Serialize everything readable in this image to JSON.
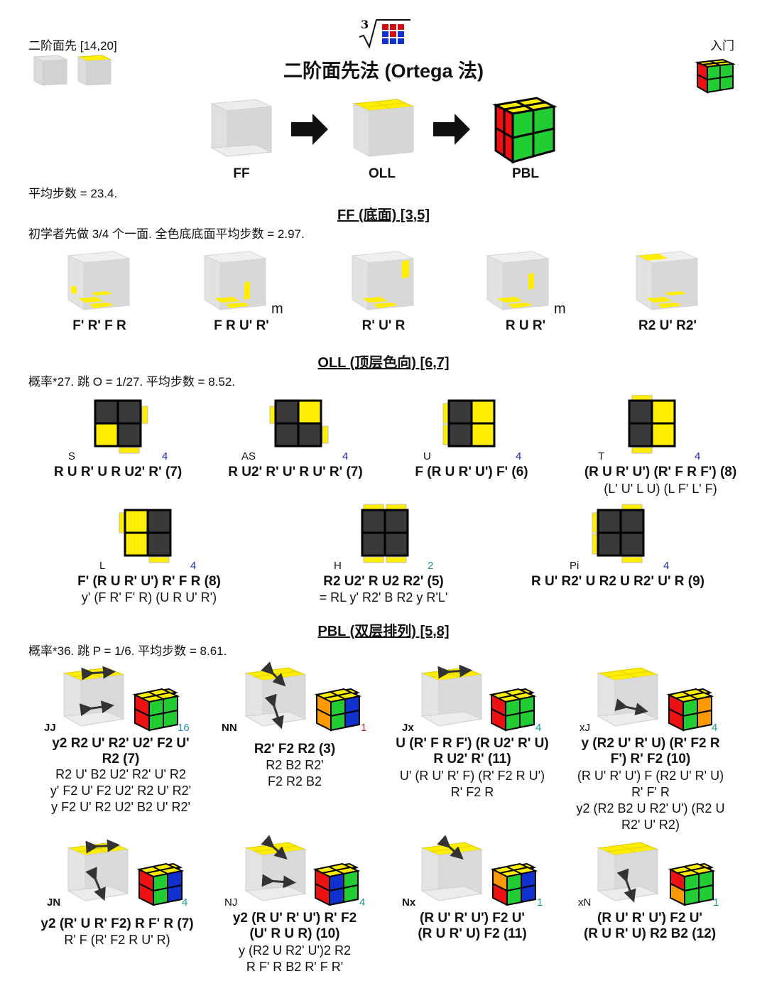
{
  "header": {
    "left_label": "二阶面先 [14,20]",
    "right_label": "入门",
    "title": "二阶面先法 (Ortega 法)",
    "root_index": "3"
  },
  "stages": [
    "FF",
    "OLL",
    "PBL"
  ],
  "avg_moves": "平均步数 = 23.4.",
  "ff": {
    "title": "FF (底面) [3,5]",
    "desc": "初学者先做 3/4 个一面. 全色底底面平均步数 = 2.97.",
    "cases": [
      {
        "alg": "F' R' F R",
        "mark": ""
      },
      {
        "alg": "F R U' R'",
        "mark": "m"
      },
      {
        "alg": "R' U' R",
        "mark": ""
      },
      {
        "alg": "R U R'",
        "mark": "m"
      },
      {
        "alg": "R2 U' R2'",
        "mark": ""
      }
    ]
  },
  "oll": {
    "title": "OLL (顶层色向) [6,7]",
    "desc": "概率*27. 跳 O = 1/27. 平均步数 = 8.52.",
    "cases": [
      {
        "name": "S",
        "count": "4",
        "alg": "R U R' U R U2' R' (7)",
        "alt": ""
      },
      {
        "name": "AS",
        "count": "4",
        "alg": "R U2' R' U' R U' R' (7)",
        "alt": ""
      },
      {
        "name": "U",
        "count": "4",
        "alg": "F (R U R' U') F' (6)",
        "alt": ""
      },
      {
        "name": "T",
        "count": "4",
        "alg": "(R U R' U') (R' F R F') (8)",
        "alt": "(L' U' L U) (L F' L' F)"
      },
      {
        "name": "L",
        "count": "4",
        "alg": "F' (R U R' U') R' F R (8)",
        "alt": "y' (F R' F' R) (U R U' R')"
      },
      {
        "name": "H",
        "count": "2",
        "alg": "R2 U2' R U2 R2' (5)",
        "alt": "= RL y' R2' B R2 y R'L'"
      },
      {
        "name": "Pi",
        "count": "4",
        "alg": "R U' R2' U R2 U R2' U' R (9)",
        "alt": ""
      }
    ]
  },
  "pbl": {
    "title": "PBL (双层排列) [5,8]",
    "desc": "概率*36. 跳 P = 1/6. 平均步数 = 8.61.",
    "cases": [
      {
        "name": "JJ",
        "count": "16",
        "alg": [
          "y2 R2 U' R2' U2' F2 U'",
          "R2 (7)"
        ],
        "alt": [
          "R2 U' B2 U2' R2' U' R2",
          "y' F2 U' F2 U2' R2 U' R2'",
          "y F2 U' R2 U2' B2 U' R2'"
        ]
      },
      {
        "name": "NN",
        "count": "1",
        "alg": [
          "R2' F2 R2 (3)"
        ],
        "alt": [
          "R2 B2 R2'",
          "F2 R2 B2"
        ]
      },
      {
        "name": "Jx",
        "count": "4",
        "alg": [
          "U (R' F R F') (R U2' R' U)",
          "R U2' R' (11)"
        ],
        "alt": [
          "U' (R U' R' F) (R' F2 R U')",
          "R' F2 R"
        ]
      },
      {
        "name": "xJ",
        "count": "4",
        "alg": [
          "y (R2 U' R' U) (R' F2 R",
          "F') R' F2 (10)"
        ],
        "alt": [
          "(R U' R' U') F (R2 U' R' U)",
          "R' F' R",
          "y2 (R2 B2 U R2' U') (R2 U",
          "R2' U' R2)"
        ]
      },
      {
        "name": "JN",
        "count": "4",
        "alg": [
          "y2 (R' U R' F2) R F' R (7)"
        ],
        "alt": [
          "R' F (R' F2 R U' R)"
        ]
      },
      {
        "name": "NJ",
        "count": "4",
        "alg": [
          "y2 (R U' R' U') R' F2",
          "(U' R U R) (10)"
        ],
        "alt": [
          "y (R2 U R2' U')2 R2",
          "R F' R B2 R' F R'"
        ]
      },
      {
        "name": "Nx",
        "count": "1",
        "alg": [
          "(R U' R' U') F2 U'",
          "(R U R' U) F2 (11)"
        ],
        "alt": []
      },
      {
        "name": "xN",
        "count": "1",
        "alg": [
          "(R U' R' U') F2 U'",
          "(R U R' U) R2 B2 (12)"
        ],
        "alt": []
      }
    ]
  },
  "colors": {
    "yellow": "#ffee00",
    "red": "#ee1111",
    "green": "#22cc33",
    "blue": "#1030d0",
    "orange": "#ff9900",
    "dark": "#333333",
    "ghost": "#d8d8d8"
  }
}
